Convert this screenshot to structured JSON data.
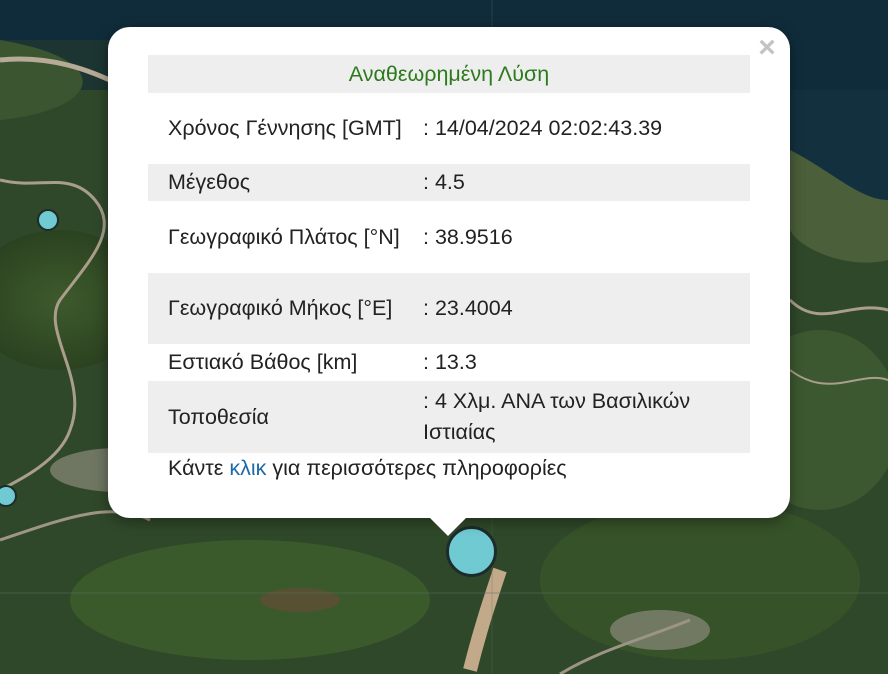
{
  "popup": {
    "title": "Αναθεωρημένη Λύση",
    "close_symbol": "×",
    "rows": [
      {
        "label": "Χρόνος Γέννησης [GMT]",
        "value": ": 14/04/2024 02:02:43.39"
      },
      {
        "label": "Μέγεθος",
        "value": ": 4.5"
      },
      {
        "label": "Γεωγραφικό Πλάτος [°N]",
        "value": ": 38.9516"
      },
      {
        "label": "Γεωγραφικό Μήκος [°E]",
        "value": ": 23.4004"
      },
      {
        "label": "Εστιακό Βάθος [km]",
        "value": ": 13.3"
      },
      {
        "label": "Τοποθεσία",
        "value": ": 4 Χλμ. ΑΝΑ των Βασιλικών Ιστιαίας"
      }
    ],
    "footer": {
      "before": "Κάντε ",
      "link": "κλικ",
      "after": " για περισσότερες πληροφορίες"
    }
  },
  "colors": {
    "marker": "#6fcad2",
    "title": "#2c7a1c",
    "link": "#1f6aa8"
  }
}
